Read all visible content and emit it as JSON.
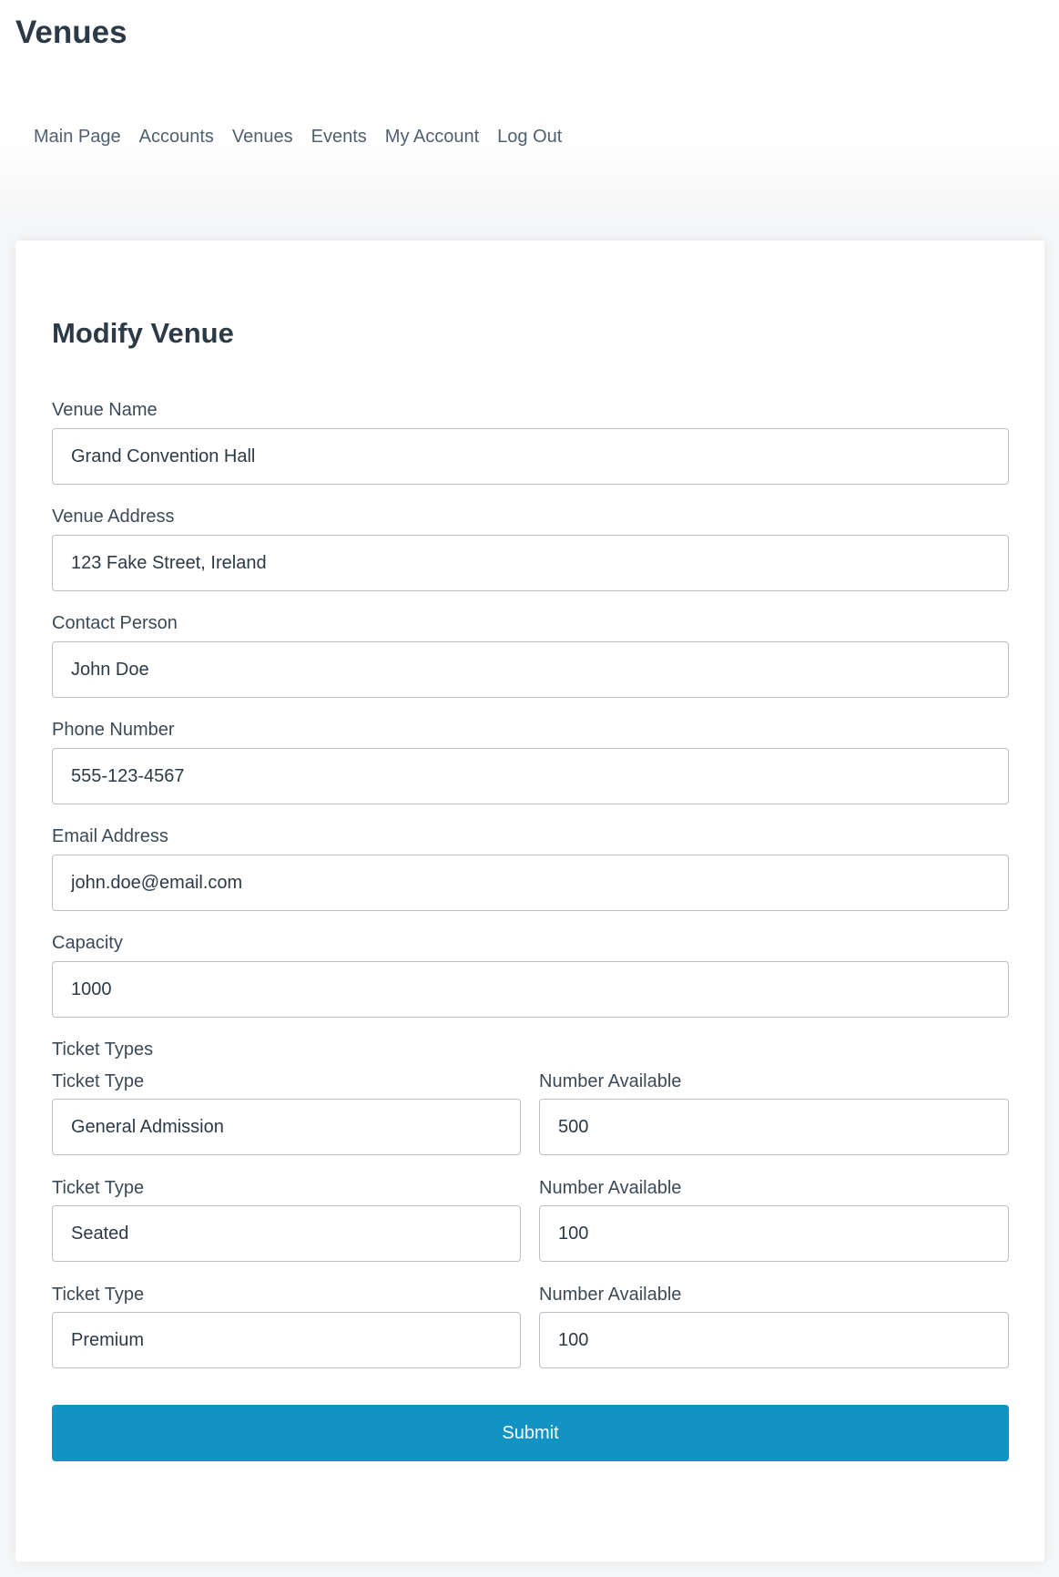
{
  "header": {
    "title": "Venues"
  },
  "nav": {
    "items": [
      "Main Page",
      "Accounts",
      "Venues",
      "Events",
      "My Account",
      "Log Out"
    ]
  },
  "form": {
    "title": "Modify Venue",
    "venue_name": {
      "label": "Venue Name",
      "value": "Grand Convention Hall"
    },
    "venue_address": {
      "label": "Venue Address",
      "value": "123 Fake Street, Ireland"
    },
    "contact_person": {
      "label": "Contact Person",
      "value": "John Doe"
    },
    "phone_number": {
      "label": "Phone Number",
      "value": "555-123-4567"
    },
    "email_address": {
      "label": "Email Address",
      "value": "john.doe@email.com"
    },
    "capacity": {
      "label": "Capacity",
      "value": "1000"
    },
    "ticket_types_heading": "Ticket Types",
    "tickets": [
      {
        "type_label": "Ticket Type",
        "type_value": "General Admission",
        "number_label": "Number Available",
        "number_value": "500"
      },
      {
        "type_label": "Ticket Type",
        "type_value": "Seated",
        "number_label": "Number Available",
        "number_value": "100"
      },
      {
        "type_label": "Ticket Type",
        "type_value": "Premium",
        "number_label": "Number Available",
        "number_value": "100"
      }
    ],
    "submit_label": "Submit"
  },
  "colors": {
    "accent": "#1193c3",
    "text": "#2c3a47",
    "nav_text": "#4f6070",
    "border": "#b9c0c6"
  }
}
